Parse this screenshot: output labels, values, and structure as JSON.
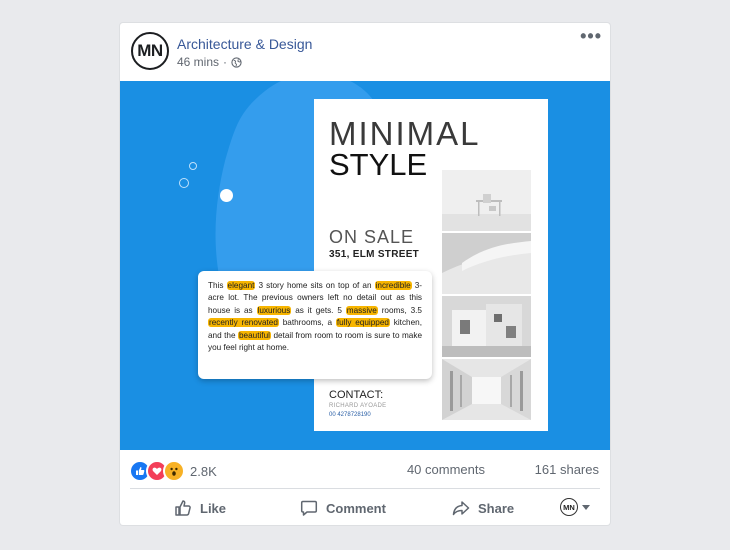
{
  "post": {
    "page_name": "Architecture & Design",
    "avatar_initials": "MN",
    "time": "46 mins",
    "privacy_icon": "globe-icon",
    "more_icon": "more-options-icon"
  },
  "flyer": {
    "title_line1": "MINIMAL",
    "title_line2": "STYLE",
    "on_sale": "ON SALE",
    "address": "351, ELM STREET",
    "contact_label": "CONTACT:",
    "contact_name": "RICHARD AYOADE",
    "contact_phone": "00 4278728190"
  },
  "description": {
    "t1": "This ",
    "h1": "elegant",
    "t2": " 3 story home sits on top of an ",
    "h2": "incredible",
    "t3": " 3-acre lot. The previous owners left no detail out as this house is as ",
    "h3": "luxurious",
    "t4": " as it gets. 5 ",
    "h4": "massive",
    "t5": " rooms, 3.5 ",
    "h5": "recently renovated",
    "t6": " bathrooms, a ",
    "h6": "fully equipped",
    "t7": " kitchen, and the ",
    "h7": "beautiful",
    "t8": " detail from room to room is sure to make you feel right at home.",
    "highlight_color": "#f7b500"
  },
  "stats": {
    "reaction_count": "2.8K",
    "comments": "40 comments",
    "shares": "161 shares",
    "reactions": [
      "like-reaction-icon",
      "love-reaction-icon",
      "wow-reaction-icon"
    ]
  },
  "actions": {
    "like": "Like",
    "comment": "Comment",
    "share": "Share",
    "avatar_initials": "MN"
  },
  "colors": {
    "media_bg": "#1a8fe3",
    "link": "#385898",
    "like_blue": "#1877f2",
    "love_red": "#f33e58",
    "wow_yellow": "#f7b125"
  }
}
